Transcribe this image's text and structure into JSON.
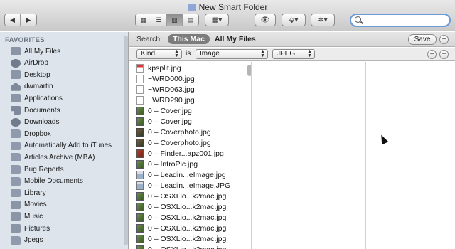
{
  "window": {
    "title": "New Smart Folder"
  },
  "toolbar": {
    "back": "◀",
    "forward": "▶",
    "views": [
      "icon-view",
      "list-view",
      "column-view",
      "coverflow-view"
    ],
    "active_view": 2,
    "arrange": "▦▾",
    "quicklook": "👁",
    "dropbox": "⬙▾",
    "action": "✲▾"
  },
  "search": {
    "placeholder": ""
  },
  "sidebar": {
    "heading": "FAVORITES",
    "items": [
      {
        "label": "All My Files",
        "icon": "all-my-files-icon"
      },
      {
        "label": "AirDrop",
        "icon": "airdrop-icon"
      },
      {
        "label": "Desktop",
        "icon": "desktop-icon"
      },
      {
        "label": "dwmartin",
        "icon": "home-icon"
      },
      {
        "label": "Applications",
        "icon": "applications-icon"
      },
      {
        "label": "Documents",
        "icon": "documents-icon"
      },
      {
        "label": "Downloads",
        "icon": "downloads-icon"
      },
      {
        "label": "Dropbox",
        "icon": "folder-icon"
      },
      {
        "label": "Automatically Add to iTunes",
        "icon": "folder-icon"
      },
      {
        "label": "Articles Archive (MBA)",
        "icon": "folder-icon"
      },
      {
        "label": "Bug Reports",
        "icon": "folder-icon"
      },
      {
        "label": "Mobile Documents",
        "icon": "folder-icon"
      },
      {
        "label": "Library",
        "icon": "folder-icon"
      },
      {
        "label": "Movies",
        "icon": "movies-icon"
      },
      {
        "label": "Music",
        "icon": "music-icon"
      },
      {
        "label": "Pictures",
        "icon": "pictures-icon"
      },
      {
        "label": "Jpegs",
        "icon": "smart-folder-gear-icon"
      }
    ]
  },
  "scope": {
    "label": "Search:",
    "this_mac": "This Mac",
    "all_files": "All My Files",
    "save": "Save",
    "minus": "−",
    "plus": "+"
  },
  "criteria": {
    "attribute": "Kind",
    "operator": "is",
    "value": "Image",
    "subtype": "JPEG",
    "minus": "−",
    "plus": "+"
  },
  "files": [
    {
      "name": "kpsplit.jpg",
      "icon": "pdf"
    },
    {
      "name": "~WRD000.jpg",
      "icon": "doc"
    },
    {
      "name": "~WRD063.jpg",
      "icon": "doc"
    },
    {
      "name": "~WRD290.jpg",
      "icon": "doc"
    },
    {
      "name": "0 – Cover.jpg",
      "icon": "img"
    },
    {
      "name": "0 – Cover.jpg",
      "icon": "img"
    },
    {
      "name": "0 – Coverphoto.jpg",
      "icon": "photo"
    },
    {
      "name": "0 – Coverphoto.jpg",
      "icon": "photo"
    },
    {
      "name": "0 – Finder...apz001.jpg",
      "icon": "red"
    },
    {
      "name": "0 – IntroPic.jpg",
      "icon": "img"
    },
    {
      "name": "0 – Leadin...eImage.jpg",
      "icon": "shot"
    },
    {
      "name": "0 – Leadin...eImage.JPG",
      "icon": "shot"
    },
    {
      "name": "0 – OSXLio...k2mac.jpg",
      "icon": "img"
    },
    {
      "name": "0 – OSXLio...k2mac.jpg",
      "icon": "img"
    },
    {
      "name": "0 – OSXLio...k2mac.jpg",
      "icon": "img"
    },
    {
      "name": "0 – OSXLio...k2mac.jpg",
      "icon": "img"
    },
    {
      "name": "0 – OSXLio...k2mac.jpg",
      "icon": "img"
    },
    {
      "name": "0 – OSXLio...k2mac.jpg",
      "icon": "img"
    }
  ]
}
